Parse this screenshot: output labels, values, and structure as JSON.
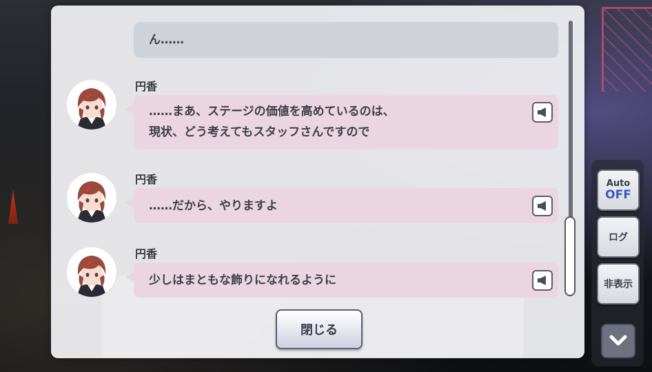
{
  "controls": {
    "auto_label": "Auto",
    "auto_state": "OFF",
    "log_label": "ログ",
    "hide_label": "非表示"
  },
  "log": {
    "narration": "ん……",
    "entries": [
      {
        "speaker": "円香",
        "lines": [
          "……まあ、ステージの価値を高めているのは、",
          "現状、どう考えてもスタッフさんですので"
        ]
      },
      {
        "speaker": "円香",
        "lines": [
          "……だから、やりますよ"
        ]
      },
      {
        "speaker": "円香",
        "lines": [
          "少しはまともな飾りになれるように"
        ]
      }
    ],
    "close_label": "閉じる"
  },
  "icons": {
    "voice": "speaker-icon",
    "down": "chevron-down-icon"
  },
  "colors": {
    "speech_bubble": "#ead5e1",
    "narration_bubble": "#cfd2d9",
    "auto_off": "#3b58c8"
  }
}
